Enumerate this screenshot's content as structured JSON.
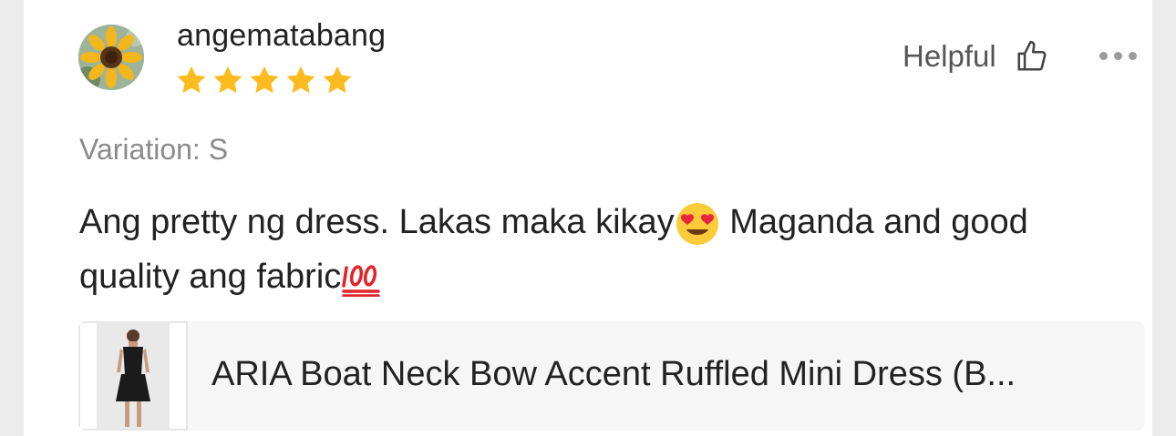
{
  "review": {
    "username": "angematabang",
    "rating": 5,
    "rating_max": 5,
    "helpful_label": "Helpful",
    "variation": "Variation: S",
    "text_part1": "Ang pretty ng dress. Lakas maka kikay",
    "text_part2": " Maganda and good quality ang fabric",
    "emojis": [
      "heart-eyes-emoji",
      "hundred-points-emoji"
    ],
    "product_title": "ARIA Boat Neck Bow Accent Ruffled Mini Dress (B..."
  },
  "colors": {
    "star": "#fdbb1f",
    "text": "#222222",
    "muted": "#8a8a8a",
    "card_bg": "#ffffff",
    "page_bg": "#ececec",
    "product_bg": "#f6f6f6"
  },
  "icons": {
    "avatar": "sunflower-avatar",
    "helpful": "thumbs-up-icon",
    "more": "more-dots-icon"
  }
}
